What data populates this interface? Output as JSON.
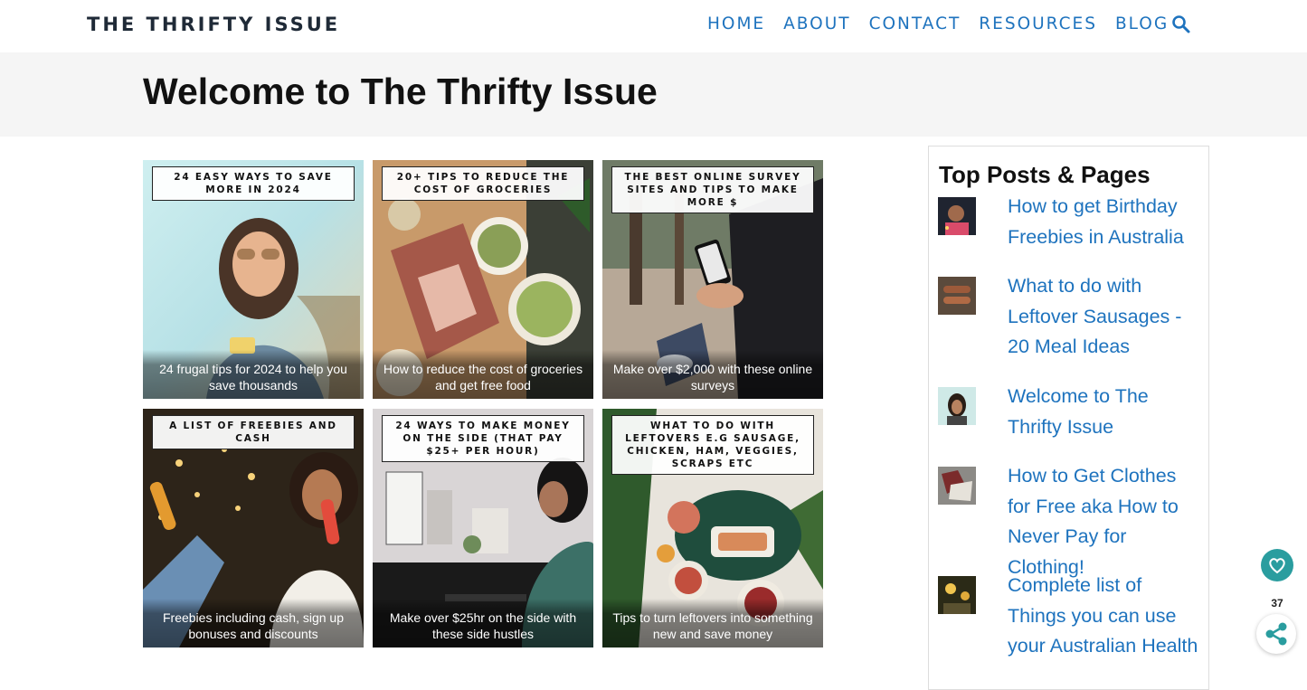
{
  "header": {
    "brand": "THE THRIFTY ISSUE",
    "nav": [
      "HOME",
      "ABOUT",
      "CONTACT",
      "RESOURCES",
      "BLOG"
    ],
    "search_icon": "search-icon"
  },
  "page": {
    "title": "Welcome to The Thrifty Issue"
  },
  "posts": [
    {
      "label": "24 EASY WAYS TO SAVE MORE IN 2024",
      "caption": "24 frugal tips for 2024 to help you save thousands"
    },
    {
      "label": "20+ TIPS TO REDUCE THE COST OF GROCERIES",
      "caption": "How to reduce the cost of groceries and get free food"
    },
    {
      "label": "THE BEST ONLINE SURVEY SITES AND TIPS TO MAKE MORE $",
      "caption": "Make over $2,000 with these online surveys"
    },
    {
      "label": "A LIST OF FREEBIES AND CASH",
      "caption": "Freebies including cash, sign up bonuses and discounts"
    },
    {
      "label": "24 WAYS TO MAKE MONEY ON THE SIDE (THAT PAY $25+ PER HOUR)",
      "caption": "Make over $25hr on the side with these side hustles"
    },
    {
      "label": "WHAT TO DO WITH LEFTOVERS E.G SAUSAGE, CHICKEN, HAM, VEGGIES, SCRAPS ETC",
      "caption": "Tips to turn leftovers into something new and save money"
    }
  ],
  "sidebar": {
    "title": "Top Posts & Pages",
    "items": [
      {
        "text": "How to get Birthday Freebies in Australia"
      },
      {
        "text": "What to do with Leftover Sausages - 20 Meal Ideas"
      },
      {
        "text": "Welcome to The Thrifty Issue"
      },
      {
        "text": "How to Get Clothes for Free aka How to Never Pay for Clothing!"
      },
      {
        "text": "Complete list of Things you can use your Australian Health"
      }
    ]
  },
  "floating": {
    "favorite_icon": "heart-icon",
    "share_count": "37",
    "share_icon": "share-icon"
  },
  "colors": {
    "link": "#1e73be",
    "brand": "#1f2a37",
    "title_band": "#f5f5f5",
    "fav_button": "#2a9d9f"
  }
}
